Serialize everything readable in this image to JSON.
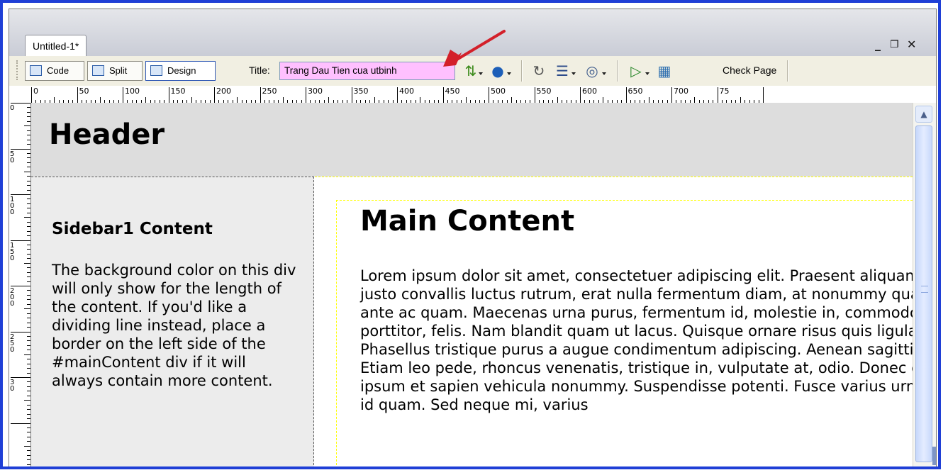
{
  "document_tab": {
    "label": "Untitled-1*"
  },
  "window_controls": {
    "minimize": "_",
    "restore": "❐",
    "close": "✕"
  },
  "toolbar": {
    "code_label": "Code",
    "split_label": "Split",
    "design_label": "Design",
    "title_label": "Title:",
    "title_value": "Trang Dau Tien cua utbinh",
    "check_page_label": "Check Page"
  },
  "ruler": {
    "top_ticks": [
      "0",
      "50",
      "100",
      "150",
      "200",
      "250",
      "300",
      "350",
      "400",
      "450",
      "500",
      "550",
      "600",
      "650",
      "700",
      "75"
    ],
    "left_ticks": [
      "0",
      "50",
      "100",
      "150",
      "200",
      "250",
      "30"
    ]
  },
  "page": {
    "header": "Header",
    "sidebar_title": "Sidebar1 Content",
    "sidebar_text": "The background color on this div will only show for the length of the content. If you'd like a dividing line instead, place a border on the left side of the #mainContent div if it will always contain more content.",
    "main_title": "Main Content",
    "main_text": "Lorem ipsum dolor sit amet, consectetuer adipiscing elit. Praesent aliquam, justo convallis luctus rutrum, erat nulla fermentum diam, at nonummy quam ante ac quam. Maecenas urna purus, fermentum id, molestie in, commodo porttitor, felis. Nam blandit quam ut lacus. Quisque ornare risus quis ligula. Phasellus tristique purus a augue condimentum adipiscing. Aenean sagittis. Etiam leo pede, rhoncus venenatis, tristique in, vulputate at, odio. Donec et ipsum et sapien vehicula nonummy. Suspendisse potenti. Fusce varius urna id quam. Sed neque mi, varius"
  },
  "colors": {
    "frame_border": "#1f3fd6",
    "title_field_bg": "#ffc0ff",
    "arrow": "#d3202a",
    "header_bg": "#dddddd",
    "sidebar_bg": "#ececec"
  }
}
